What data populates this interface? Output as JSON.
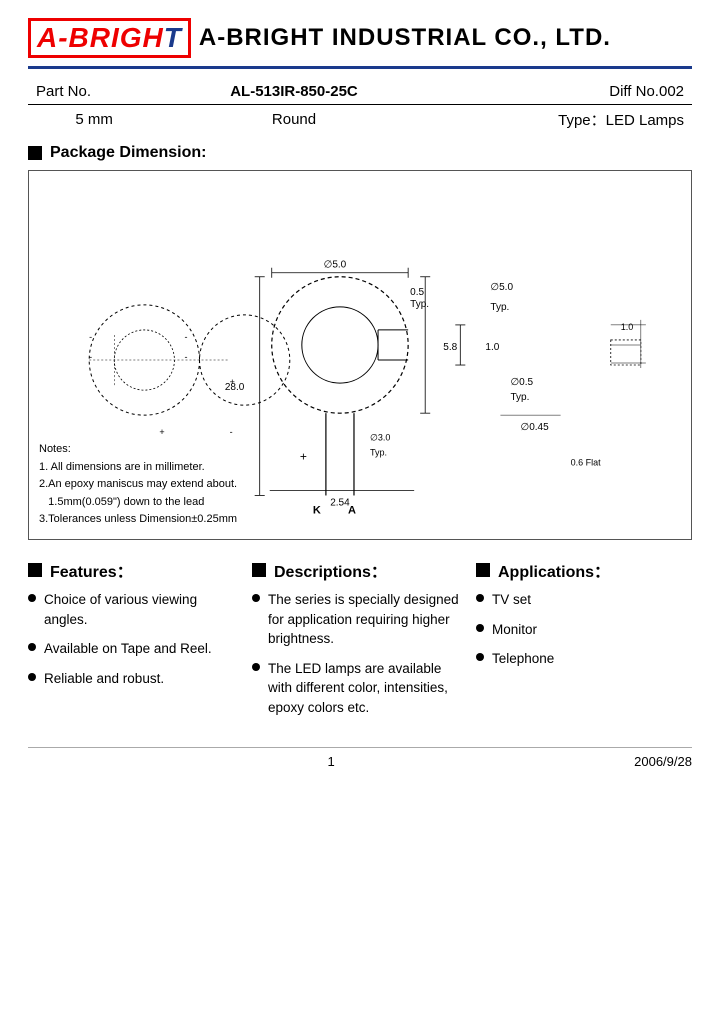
{
  "header": {
    "logo_text": "A-BRIGHT",
    "logo_blue": "T",
    "company_name": "A-BRIGHT INDUSTRIAL CO., LTD."
  },
  "part_info": {
    "part_no_label": "Part No.",
    "part_no_value": "AL-513IR-850-25C",
    "diff_no": "Diff No.002",
    "size": "5 mm",
    "shape": "Round",
    "type": "Type：LED Lamps"
  },
  "package_section": {
    "title": "Package Dimension:",
    "notes": {
      "title": "Notes:",
      "lines": [
        "1. All dimensions are in millimeter.",
        "2.An epoxy maniscus may extend about.",
        "   1.5mm(0.059\") down to the lead",
        "3.Tolerances unless Dimension±0.25mm"
      ]
    }
  },
  "features": {
    "title": "Features：",
    "items": [
      "Choice of various viewing angles.",
      "Available on Tape and Reel.",
      "Reliable and robust."
    ]
  },
  "descriptions": {
    "title": "Descriptions：",
    "items": [
      "The series is specially designed for application requiring higher brightness.",
      "The LED lamps are available with different color, intensities, epoxy colors etc."
    ]
  },
  "applications": {
    "title": "Applications：",
    "items": [
      "TV set",
      "Monitor",
      "Telephone"
    ]
  },
  "footer": {
    "page_number": "1",
    "date": "2006/9/28"
  }
}
